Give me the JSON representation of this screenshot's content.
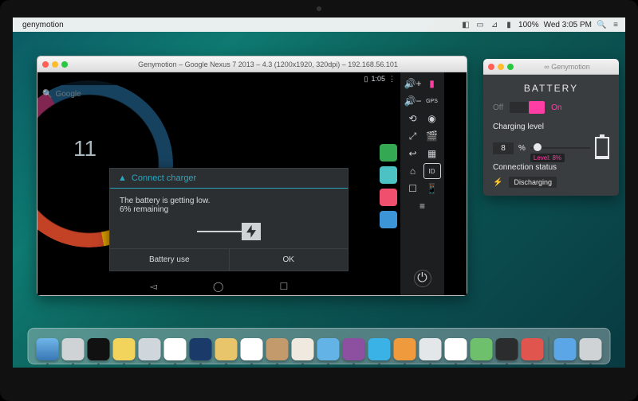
{
  "menubar": {
    "app_name": "genymotion",
    "battery_pct": "100%",
    "clock": "Wed 3:05 PM"
  },
  "emulator_window": {
    "title": "Genymotion – Google Nexus 7 2013 – 4.3 (1200x1920, 320dpi) – 192.168.56.101"
  },
  "android": {
    "status_time": "1:05",
    "search_hint": "Google",
    "clock_widget": "11",
    "dialog": {
      "title": "Connect charger",
      "line1": "The battery is getting low.",
      "line2": "6% remaining",
      "btn_left": "Battery use",
      "btn_right": "OK"
    }
  },
  "control_panel": {
    "items": [
      "volume-up",
      "battery",
      "volume-down",
      "gps",
      "rotate",
      "camera",
      "fullscreen",
      "movie",
      "back",
      "pixel",
      "home",
      "id",
      "recent",
      "remote",
      "menu",
      "power"
    ]
  },
  "battery_panel": {
    "window_title": "Genymotion",
    "header": "BATTERY",
    "off_label": "Off",
    "on_label": "On",
    "switch_on": true,
    "charging_label": "Charging level",
    "level_value": "8",
    "percent": "%",
    "slider_tip": "Level: 8%",
    "connection_label": "Connection status",
    "connection_state": "Discharging"
  },
  "dock": {
    "apps": [
      "finder",
      "launchpad",
      "terminal",
      "notes",
      "safari",
      "chrome",
      "virtualbox",
      "mail",
      "calendar",
      "contacts",
      "reminders",
      "messages",
      "photobooth",
      "itunes",
      "maps",
      "numbers",
      "pages",
      "preview",
      "genymotion",
      "appstore",
      "settings",
      "trash"
    ]
  }
}
